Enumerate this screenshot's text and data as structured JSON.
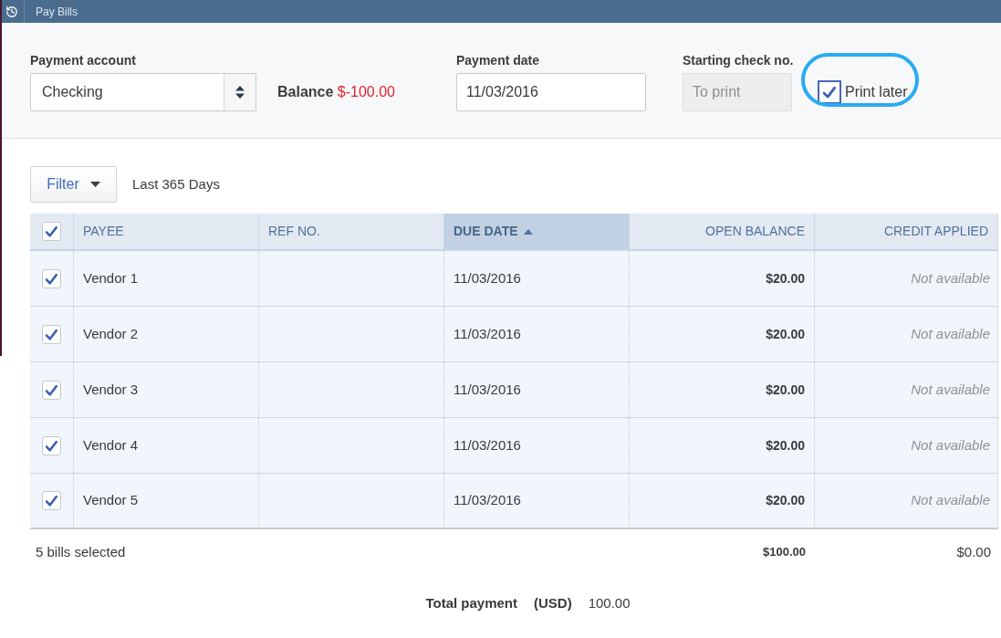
{
  "window": {
    "title": "Pay Bills"
  },
  "payment_account": {
    "label": "Payment account",
    "value": "Checking"
  },
  "balance": {
    "label": "Balance",
    "amount": "$-100.00"
  },
  "payment_date": {
    "label": "Payment date",
    "value": "11/03/2016"
  },
  "starting_check_no": {
    "label": "Starting check no.",
    "placeholder": "To print",
    "disabled": true
  },
  "print_later": {
    "label": "Print later",
    "checked": true,
    "highlighted": true
  },
  "filter": {
    "button": "Filter",
    "range": "Last 365 Days"
  },
  "table": {
    "select_all": {
      "checked": true
    },
    "columns": [
      {
        "label": "PAYEE",
        "sorted": false
      },
      {
        "label": "REF NO.",
        "sorted": false
      },
      {
        "label": "DUE DATE",
        "sorted": true
      },
      {
        "label": "OPEN BALANCE",
        "sorted": false
      },
      {
        "label": "CREDIT APPLIED",
        "sorted": false
      }
    ],
    "rows": [
      {
        "checked": true,
        "payee": "Vendor 1",
        "due_date": "11/03/2016",
        "open_balance": "$20.00",
        "credit_applied": "Not available"
      },
      {
        "checked": true,
        "payee": "Vendor 2",
        "due_date": "11/03/2016",
        "open_balance": "$20.00",
        "credit_applied": "Not available"
      },
      {
        "checked": true,
        "payee": "Vendor 3",
        "due_date": "11/03/2016",
        "open_balance": "$20.00",
        "credit_applied": "Not available"
      },
      {
        "checked": true,
        "payee": "Vendor 4",
        "due_date": "11/03/2016",
        "open_balance": "$20.00",
        "credit_applied": "Not available"
      },
      {
        "checked": true,
        "payee": "Vendor 5",
        "due_date": "11/03/2016",
        "open_balance": "$20.00",
        "credit_applied": "Not available"
      }
    ]
  },
  "footer": {
    "selected_count": "5 bills selected",
    "open_balance_total": "$100.00",
    "credit_total": "$0.00"
  },
  "total_payment": {
    "label": "Total payment",
    "currency": "(USD)",
    "amount": "100.00"
  }
}
